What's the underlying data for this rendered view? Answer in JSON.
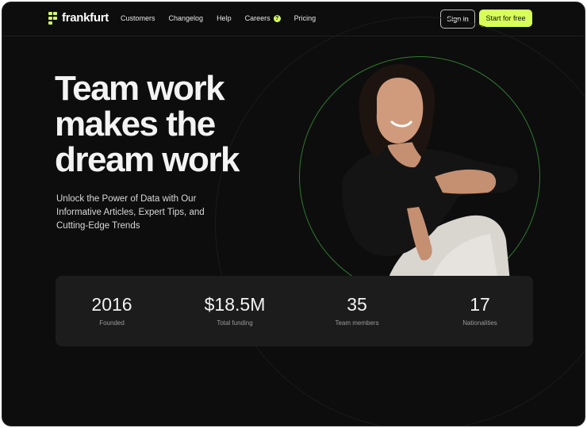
{
  "brand": {
    "name": "frankfurt",
    "accent": "#d7ff5a"
  },
  "nav": {
    "items": [
      {
        "label": "Customers"
      },
      {
        "label": "Changelog"
      },
      {
        "label": "Help"
      },
      {
        "label": "Careers",
        "badge": "?"
      },
      {
        "label": "Pricing"
      }
    ],
    "sign_in": "Sign in",
    "start": "Start for free"
  },
  "hero": {
    "headline": [
      "Team work",
      "makes the",
      "dream work"
    ],
    "subtitle": "Unlock the Power of Data with Our Informative Articles, Expert Tips, and Cutting-Edge Trends"
  },
  "stats": [
    {
      "value": "2016",
      "label": "Founded"
    },
    {
      "value": "$18.5M",
      "label": "Total funding"
    },
    {
      "value": "35",
      "label": "Team members"
    },
    {
      "value": "17",
      "label": "Nationalities"
    }
  ]
}
